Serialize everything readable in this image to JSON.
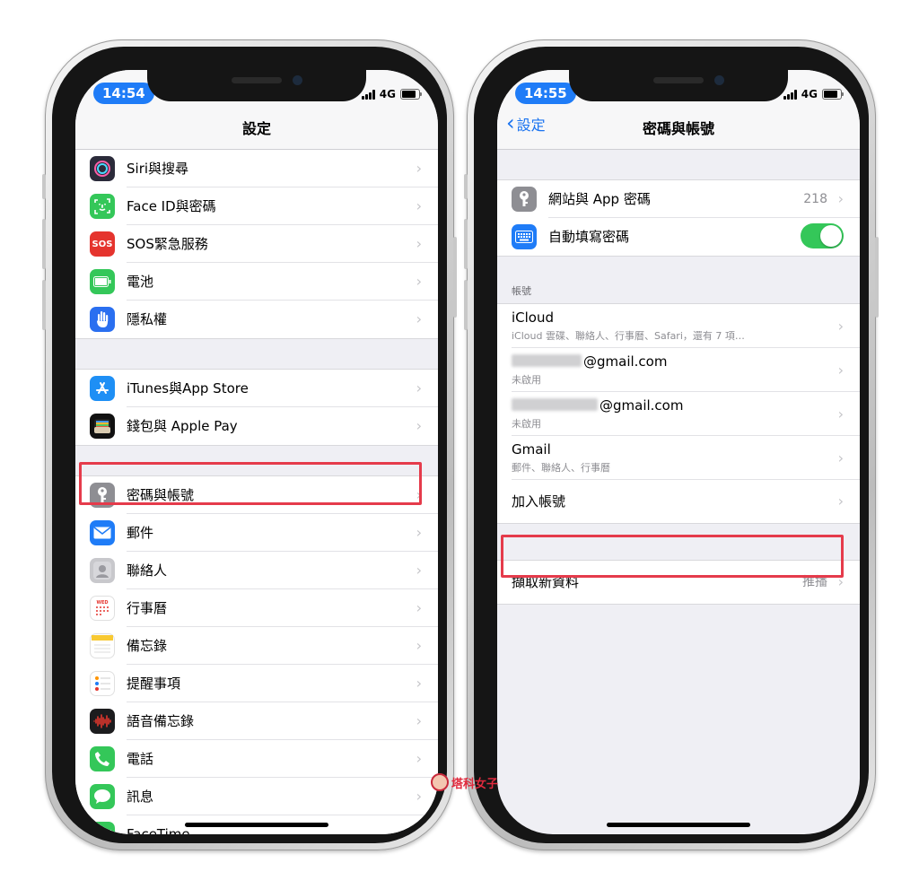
{
  "left_phone": {
    "status": {
      "time": "14:54",
      "network": "4G"
    },
    "nav_title": "設定",
    "groups": [
      [
        {
          "label": "Siri與搜尋",
          "icon": "siri-icon",
          "color": "#2b2b3a"
        },
        {
          "label": "Face ID與密碼",
          "icon": "face-id-icon",
          "color": "#34c759"
        },
        {
          "label": "SOS緊急服務",
          "icon": "sos-icon",
          "color": "#e5342e",
          "glyph": "SOS"
        },
        {
          "label": "電池",
          "icon": "battery-icon",
          "color": "#34c759"
        },
        {
          "label": "隱私權",
          "icon": "hand-icon",
          "color": "#2a6ff0"
        }
      ],
      [
        {
          "label": "iTunes與App Store",
          "icon": "app-store-icon",
          "color": "#1e8ff5"
        },
        {
          "label": "錢包與 Apple Pay",
          "icon": "wallet-icon",
          "color": "#111111"
        }
      ],
      [
        {
          "label": "密碼與帳號",
          "icon": "key-icon",
          "color": "#8e8e93"
        },
        {
          "label": "郵件",
          "icon": "mail-icon",
          "color": "#1f7cf7"
        },
        {
          "label": "聯絡人",
          "icon": "contacts-icon",
          "color": "#c8c8cc"
        },
        {
          "label": "行事曆",
          "icon": "calendar-icon",
          "color": "#ffffff"
        },
        {
          "label": "備忘錄",
          "icon": "notes-icon",
          "color": "#ffffff"
        },
        {
          "label": "提醒事項",
          "icon": "reminders-icon",
          "color": "#ffffff"
        },
        {
          "label": "語音備忘錄",
          "icon": "voice-memos-icon",
          "color": "#1c1c1e"
        },
        {
          "label": "電話",
          "icon": "phone-icon",
          "color": "#34c759"
        },
        {
          "label": "訊息",
          "icon": "messages-icon",
          "color": "#34c759"
        },
        {
          "label": "FaceTime",
          "icon": "facetime-icon",
          "color": "#34c759"
        }
      ]
    ]
  },
  "right_phone": {
    "status": {
      "time": "14:55",
      "network": "4G"
    },
    "back_label": "設定",
    "nav_title": "密碼與帳號",
    "passwords": {
      "label": "網站與 App 密碼",
      "count": "218"
    },
    "autofill": {
      "label": "自動填寫密碼",
      "on": true
    },
    "accounts_header": "帳號",
    "accounts": [
      {
        "title": "iCloud",
        "subtitle": "iCloud 雲碟、聯絡人、行事曆、Safari，還有 7 項…",
        "redacted": false
      },
      {
        "title": "@gmail.com",
        "subtitle": "未啟用",
        "redacted": true
      },
      {
        "title": "@gmail.com",
        "subtitle": "未啟用",
        "redacted": true
      },
      {
        "title": "Gmail",
        "subtitle": "郵件、聯絡人、行事曆",
        "redacted": false
      }
    ],
    "add_account": "加入帳號",
    "fetch": {
      "label": "擷取新資料",
      "value": "推播"
    }
  },
  "watermark": "塔科女子",
  "highlight_color": "#e53b4b"
}
